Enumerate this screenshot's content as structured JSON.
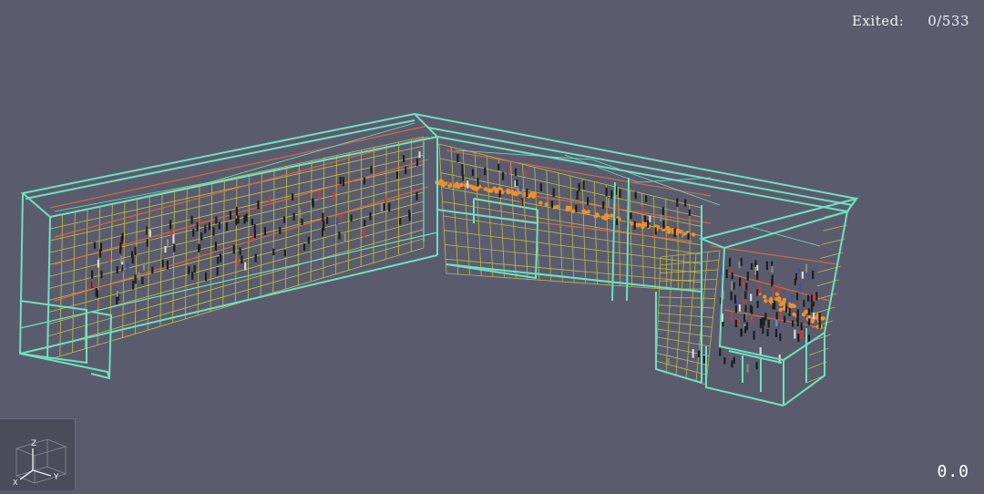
{
  "hud": {
    "exited_label": "Exited:",
    "exited_value": "0/533"
  },
  "axes": {
    "z": "Z",
    "y": "Y",
    "x": "X"
  },
  "timer": "0.0",
  "colors": {
    "background": "#5a5c6e",
    "outer_walls": "#6fe0c0",
    "inner_grid": "#d8d24a",
    "stair_rails": "#e8703a",
    "agents_orange": "#f0902a"
  }
}
